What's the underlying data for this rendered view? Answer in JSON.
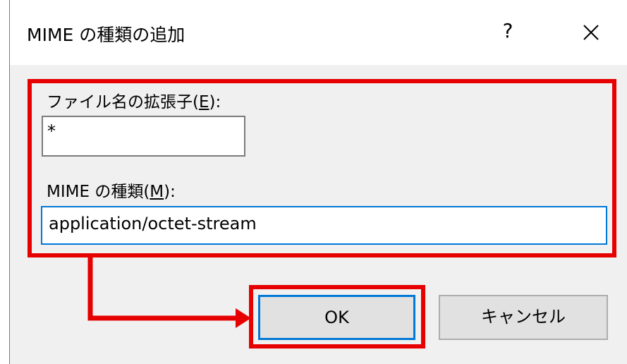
{
  "dialog": {
    "title": "MIME の種類の追加",
    "help_label": "?",
    "close_icon": "close-icon"
  },
  "extension_field": {
    "label_prefix": "ファイル名の拡張子(",
    "label_accel": "E",
    "label_suffix": "):",
    "value": "*"
  },
  "mime_field": {
    "label_prefix": "MIME の種類(",
    "label_accel": "M",
    "label_suffix": "):",
    "value": "application/octet-stream"
  },
  "buttons": {
    "ok_label": "OK",
    "cancel_label": "キャンセル"
  },
  "annotation": {
    "highlight_color": "#e60000",
    "arrow_icon": "arrow-right-icon"
  }
}
